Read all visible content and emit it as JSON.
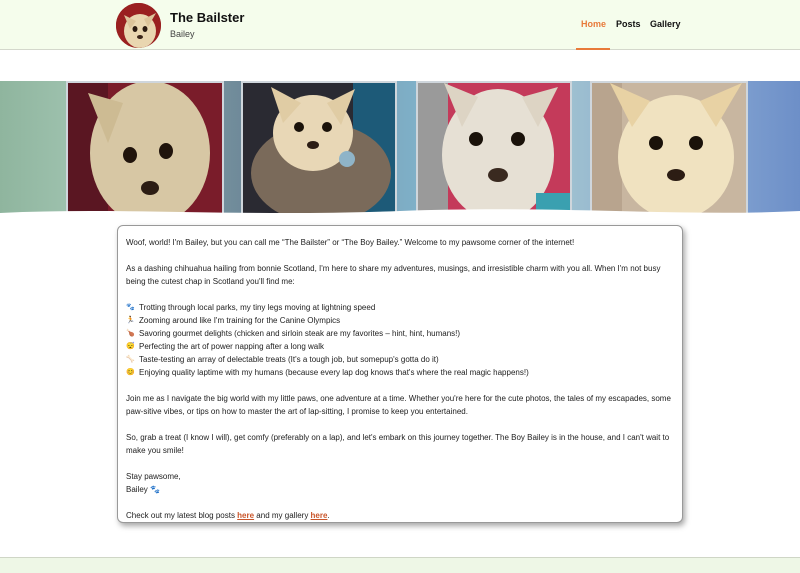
{
  "header": {
    "site_title": "The Bailster",
    "site_subtitle": "Bailey",
    "nav": [
      {
        "label": "Home",
        "active": true
      },
      {
        "label": "Posts",
        "active": false
      },
      {
        "label": "Gallery",
        "active": false
      }
    ]
  },
  "content": {
    "intro": "Woof, world! I'm Bailey, but you can call me “The Bailster” or “The Boy Bailey.” Welcome to my pawsome corner of the internet!",
    "para1": "As a dashing chihuahua hailing from bonnie Scotland, I'm here to share my adventures, musings, and irresistible charm with you all. When I'm not busy being the cutest chap in Scotland you'll find me:",
    "list": [
      {
        "icon": "paw-prints-icon",
        "glyph": "🐾",
        "text": "Trotting through local parks, my tiny legs moving at lightning speed"
      },
      {
        "icon": "running-icon",
        "glyph": "🏃",
        "text": "Zooming around like I'm training for the Canine Olympics"
      },
      {
        "icon": "drumstick-icon",
        "glyph": "🍗",
        "text": "Savoring gourmet delights (chicken and sirloin steak are my favorites – hint, hint, humans!)"
      },
      {
        "icon": "sleep-icon",
        "glyph": "😴",
        "text": "Perfecting the art of power napping after a long walk"
      },
      {
        "icon": "bone-icon",
        "glyph": "🦴",
        "text": "Taste-testing an array of delectable treats (It's a tough job, but somepup's gotta do it)"
      },
      {
        "icon": "smile-icon",
        "glyph": "😊",
        "text": "Enjoying quality laptime with my humans (because every lap dog knows that's where the real magic happens!)"
      }
    ],
    "para2": "Join me as I navigate the big world with my little paws, one adventure at a time. Whether you're here for the cute photos, the tales of my escapades, some paw-sitive vibes, or tips on how to master the art of lap-sitting, I promise to keep you entertained.",
    "para3": "So, grab a treat (I know I will), get comfy (preferably on a lap), and let's embark on this journey together. The Boy Bailey is in the house, and I can't wait to make you smile!",
    "signoff": "Stay pawsome,",
    "signature": "Bailey 🐾",
    "cta_prefix": "Check out my latest blog posts ",
    "cta_link1": "here",
    "cta_middle": " and my gallery ",
    "cta_link2": "here",
    "cta_suffix": "."
  }
}
